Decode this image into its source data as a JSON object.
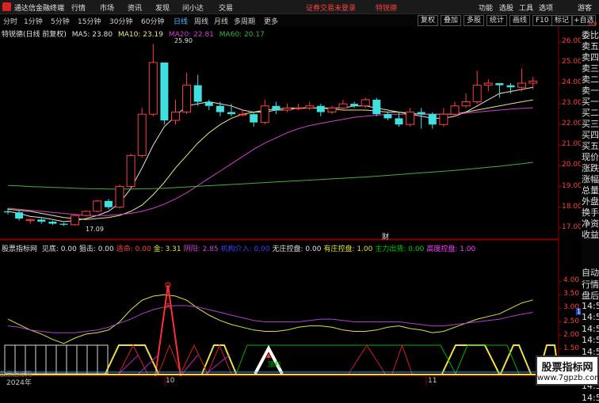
{
  "menu": {
    "app_title": "通达信金融终端",
    "items": [
      "行情",
      "市场",
      "资讯",
      "发现",
      "问小达",
      "交易"
    ],
    "login_status": "证券交易未登录",
    "stock_link": "特锐德",
    "right_items": [
      "功能",
      "选股",
      "工具",
      "选项",
      "游客"
    ]
  },
  "toolbar": {
    "periods": [
      "分时",
      "1分钟",
      "5分钟",
      "15分钟",
      "30分钟",
      "60分钟",
      "日线",
      "周线",
      "月线",
      "多周期",
      "更多"
    ],
    "active_period": "日线",
    "buttons": [
      "复权",
      "叠加",
      "多股",
      "统计",
      "画线",
      "F10",
      "标记",
      "+自选"
    ]
  },
  "main_chart": {
    "title": "特锐德(日线 前复权)",
    "ma5_label": "MA5: 23.80",
    "ma10_label": "MA10: 23.19",
    "ma20_label": "MA20: 22.81",
    "ma60_label": "MA60: 20.17",
    "high_label": "25.90",
    "low_label": "17.09",
    "y_ticks": [
      "26.00",
      "25.00",
      "24.00",
      "23.00",
      "22.00",
      "21.00",
      "20.00",
      "19.00",
      "18.00",
      "17.00"
    ],
    "top_scale": "500",
    "event_icon": "财",
    "colors": {
      "ma5": "#e0e0e0",
      "ma10": "#e8e880",
      "ma20": "#d040d0",
      "ma60": "#40b040",
      "up": "#ff4040",
      "down": "#40e0e0"
    }
  },
  "indicator": {
    "name": "股票指标网",
    "values": [
      {
        "text": "见底: 0.00",
        "color": "#e0e0e0"
      },
      {
        "text": "狙击: 0.00",
        "color": "#e0e0e0"
      },
      {
        "text": "逃命: 0.00",
        "color": "#ff4040"
      },
      {
        "text": "金: 3.31",
        "color": "#e0e040"
      },
      {
        "text": "阴阳: 2.85",
        "color": "#d040d0"
      },
      {
        "text": "机构介入: 0.00",
        "color": "#4040ff"
      },
      {
        "text": "无庄控盘: 0.00",
        "color": "#e0e0e0"
      },
      {
        "text": "有庄控盘: 1.00",
        "color": "#e0e040"
      },
      {
        "text": "主力出货: 0.00",
        "color": "#00d000"
      },
      {
        "text": "高度控盘: 1.00",
        "color": "#ff40ff"
      }
    ],
    "y_ticks": [
      "4.00",
      "3.50",
      "3.00",
      "2.50",
      "2.00",
      "1.50",
      "1.00"
    ],
    "current_value": "1.97",
    "tian_label": "天",
    "ding_label": "顶利"
  },
  "side_panel": [
    "委比",
    "卖五",
    "卖四",
    "卖三",
    "卖二",
    "卖一",
    "买一",
    "买二",
    "买三",
    "买四",
    "买五",
    "现价",
    "涨跌",
    "涨幅",
    "总量",
    "外盘",
    "换手",
    "净资",
    "收益",
    "自动",
    "行情",
    "盘后",
    "14:50",
    "14:50",
    "14:50",
    "14:50",
    "14:50",
    "14:50",
    "14:50",
    "14:50",
    "14:50"
  ],
  "x_dates": [
    "2024年",
    "10",
    "11"
  ],
  "watermark": "股票指标网",
  "badge": {
    "title": "股票指标网",
    "url": "www.7gpzb.com"
  },
  "chart_data": [
    {
      "type": "candlestick",
      "title": "特锐德(日线 前复权)",
      "ylim": [
        16.8,
        26.3
      ],
      "candles": [
        [
          17.8,
          17.75,
          17.95,
          17.65
        ],
        [
          17.75,
          17.45,
          17.85,
          17.35
        ],
        [
          17.35,
          17.4,
          17.45,
          17.2
        ],
        [
          17.4,
          17.3,
          17.5,
          17.2
        ],
        [
          17.3,
          17.2,
          17.35,
          17.15
        ],
        [
          17.2,
          17.15,
          17.25,
          17.09
        ],
        [
          17.15,
          17.6,
          17.65,
          17.1
        ],
        [
          17.6,
          17.8,
          17.85,
          17.55
        ],
        [
          17.8,
          18.3,
          18.35,
          17.75
        ],
        [
          18.3,
          18.0,
          18.4,
          17.9
        ],
        [
          18.0,
          19.0,
          19.1,
          17.95
        ],
        [
          19.0,
          20.5,
          20.6,
          18.9
        ],
        [
          20.5,
          22.5,
          22.8,
          20.4
        ],
        [
          22.5,
          25.0,
          25.9,
          22.4
        ],
        [
          25.0,
          22.2,
          24.2,
          22.0
        ],
        [
          22.2,
          22.6,
          23.2,
          22.0
        ],
        [
          22.6,
          23.9,
          24.5,
          22.5
        ],
        [
          23.9,
          23.1,
          24.4,
          22.9
        ],
        [
          23.1,
          22.9,
          23.2,
          22.7
        ],
        [
          22.9,
          22.6,
          23.1,
          22.4
        ],
        [
          22.6,
          22.5,
          23.0,
          22.4
        ],
        [
          22.5,
          22.5,
          22.7,
          22.4
        ],
        [
          22.5,
          22.1,
          22.6,
          21.9
        ],
        [
          22.1,
          22.9,
          23.2,
          22.0
        ],
        [
          22.9,
          22.7,
          23.1,
          22.5
        ],
        [
          22.7,
          22.8,
          23.0,
          22.6
        ],
        [
          22.8,
          22.8,
          23.0,
          22.7
        ],
        [
          22.8,
          22.9,
          23.1,
          22.7
        ],
        [
          22.9,
          22.6,
          23.0,
          22.4
        ],
        [
          22.6,
          22.8,
          22.9,
          22.5
        ],
        [
          22.8,
          23.0,
          23.2,
          22.7
        ],
        [
          23.0,
          22.9,
          23.1,
          22.8
        ],
        [
          22.9,
          23.2,
          23.3,
          22.8
        ],
        [
          23.2,
          22.5,
          23.3,
          22.4
        ],
        [
          22.5,
          22.3,
          22.6,
          22.2
        ],
        [
          22.3,
          22.0,
          22.6,
          21.9
        ],
        [
          22.0,
          22.6,
          22.8,
          21.9
        ],
        [
          22.6,
          22.5,
          22.8,
          21.8
        ],
        [
          22.5,
          22.0,
          22.6,
          21.8
        ],
        [
          22.0,
          22.5,
          22.8,
          21.9
        ],
        [
          22.5,
          22.9,
          23.1,
          22.4
        ],
        [
          22.9,
          23.1,
          23.5,
          22.8
        ],
        [
          23.1,
          23.9,
          24.6,
          23.0
        ],
        [
          23.9,
          24.0,
          24.2,
          23.6
        ],
        [
          24.0,
          23.9,
          24.0,
          23.3
        ],
        [
          23.9,
          23.8,
          24.0,
          23.5
        ],
        [
          23.8,
          24.0,
          24.7,
          23.6
        ],
        [
          24.0,
          24.1,
          24.3,
          23.7
        ]
      ],
      "series": [
        {
          "name": "MA5",
          "values": [
            17.8,
            17.7,
            17.55,
            17.5,
            17.4,
            17.3,
            17.35,
            17.45,
            17.6,
            17.8,
            18.2,
            18.9,
            19.9,
            21.0,
            21.9,
            22.4,
            22.9,
            23.0,
            23.1,
            23.0,
            22.9,
            22.7,
            22.6,
            22.6,
            22.7,
            22.7,
            22.8,
            22.8,
            22.8,
            22.8,
            22.8,
            22.9,
            22.9,
            22.8,
            22.7,
            22.6,
            22.5,
            22.4,
            22.3,
            22.3,
            22.4,
            22.6,
            22.9,
            23.2,
            23.5,
            23.6,
            23.7,
            23.8
          ]
        },
        {
          "name": "MA10",
          "values": [
            17.9,
            17.85,
            17.8,
            17.7,
            17.6,
            17.5,
            17.45,
            17.4,
            17.45,
            17.5,
            17.6,
            17.8,
            18.1,
            18.6,
            19.2,
            19.9,
            20.5,
            21.1,
            21.6,
            22.0,
            22.3,
            22.5,
            22.6,
            22.7,
            22.75,
            22.8,
            22.8,
            22.8,
            22.8,
            22.75,
            22.7,
            22.7,
            22.7,
            22.65,
            22.6,
            22.6,
            22.55,
            22.5,
            22.5,
            22.5,
            22.5,
            22.6,
            22.7,
            22.8,
            22.9,
            23.0,
            23.1,
            23.19
          ]
        },
        {
          "name": "MA20",
          "values": [
            17.95,
            17.9,
            17.85,
            17.8,
            17.75,
            17.7,
            17.65,
            17.6,
            17.6,
            17.6,
            17.65,
            17.7,
            17.8,
            17.95,
            18.15,
            18.4,
            18.7,
            19.05,
            19.4,
            19.75,
            20.1,
            20.45,
            20.8,
            21.1,
            21.35,
            21.6,
            21.8,
            21.95,
            22.05,
            22.15,
            22.25,
            22.35,
            22.4,
            22.45,
            22.5,
            22.5,
            22.5,
            22.5,
            22.5,
            22.5,
            22.5,
            22.55,
            22.6,
            22.65,
            22.7,
            22.75,
            22.78,
            22.81
          ]
        },
        {
          "name": "MA60",
          "values": [
            19.05,
            19.03,
            19.0,
            18.98,
            18.96,
            18.94,
            18.92,
            18.9,
            18.89,
            18.88,
            18.88,
            18.88,
            18.89,
            18.9,
            18.92,
            18.95,
            18.98,
            19.01,
            19.04,
            19.07,
            19.1,
            19.13,
            19.16,
            19.19,
            19.22,
            19.25,
            19.28,
            19.31,
            19.34,
            19.37,
            19.4,
            19.43,
            19.46,
            19.5,
            19.54,
            19.58,
            19.62,
            19.66,
            19.7,
            19.74,
            19.78,
            19.83,
            19.88,
            19.93,
            19.98,
            20.05,
            20.1,
            20.17
          ]
        }
      ]
    },
    {
      "type": "line",
      "title": "股票指标网",
      "ylim": [
        0.7,
        4.3
      ],
      "series": [
        {
          "name": "金",
          "values": [
            2.6,
            2.4,
            2.2,
            2.05,
            1.85,
            1.7,
            1.9,
            2.05,
            2.1,
            2.2,
            2.5,
            2.95,
            3.3,
            3.45,
            3.5,
            3.45,
            3.3,
            3.0,
            2.75,
            2.55,
            2.4,
            2.3,
            2.2,
            2.15,
            2.15,
            2.2,
            2.3,
            2.35,
            2.35,
            2.3,
            2.2,
            2.15,
            2.15,
            2.2,
            2.3,
            2.35,
            2.25,
            2.2,
            2.1,
            2.15,
            2.3,
            2.45,
            2.6,
            2.7,
            2.8,
            3.0,
            3.2,
            3.31
          ]
        },
        {
          "name": "阴阳",
          "values": [
            2.35,
            2.3,
            2.2,
            2.15,
            2.1,
            2.1,
            2.1,
            2.15,
            2.2,
            2.3,
            2.45,
            2.6,
            2.8,
            2.95,
            3.05,
            3.1,
            3.1,
            3.05,
            2.95,
            2.85,
            2.75,
            2.65,
            2.55,
            2.5,
            2.5,
            2.5,
            2.5,
            2.55,
            2.6,
            2.6,
            2.55,
            2.5,
            2.5,
            2.5,
            2.5,
            2.5,
            2.45,
            2.4,
            2.35,
            2.35,
            2.4,
            2.45,
            2.5,
            2.55,
            2.6,
            2.7,
            2.78,
            2.85
          ]
        }
      ]
    }
  ]
}
